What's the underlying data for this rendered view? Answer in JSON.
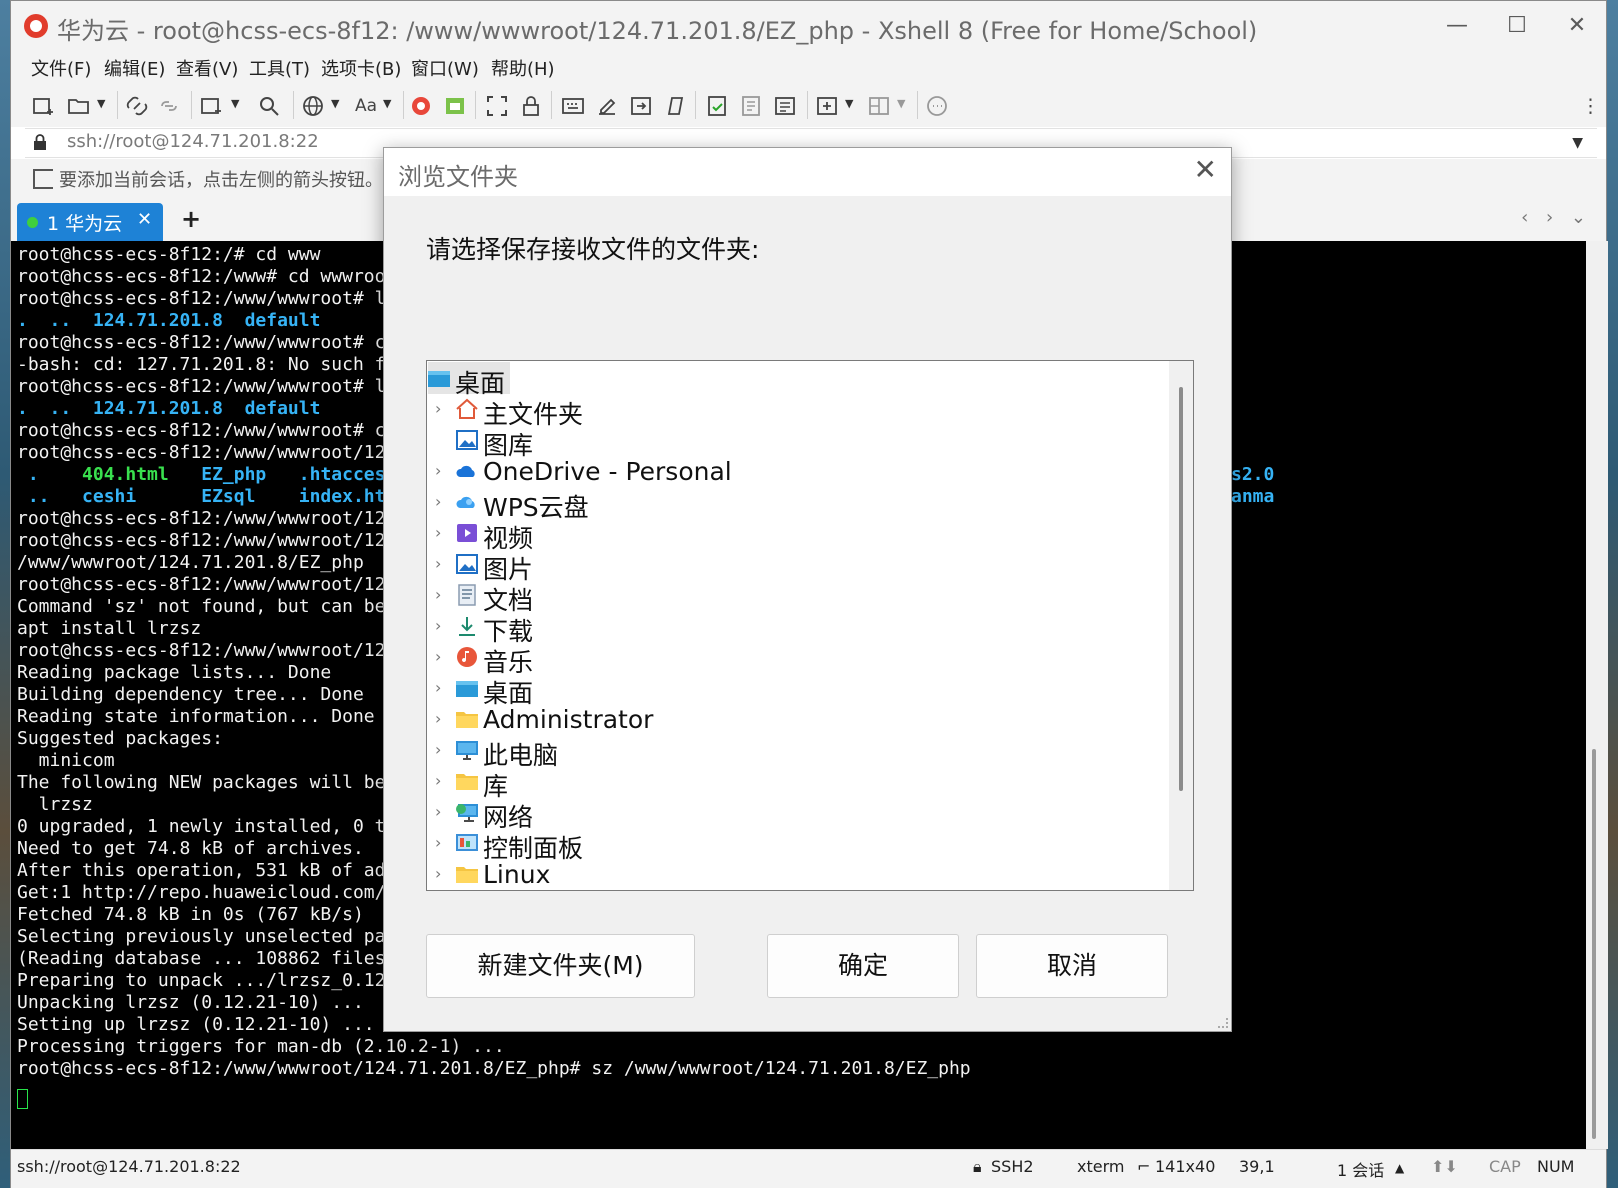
{
  "window": {
    "title": "华为云 - root@hcss-ecs-8f12: /www/wwwroot/124.71.201.8/EZ_php - Xshell 8 (Free for Home/School)",
    "minimize_glyph": "—",
    "maximize_glyph": "☐",
    "close_glyph": "✕"
  },
  "menu": [
    "文件(F)",
    "编辑(E)",
    "查看(V)",
    "工具(T)",
    "选项卡(B)",
    "窗口(W)",
    "帮助(H)"
  ],
  "toolbar": {
    "font_label": "Aa",
    "icons": [
      "new-session-icon",
      "open-folder-icon",
      "connect-icon",
      "disconnect-icon",
      "new-tab-icon",
      "search-icon",
      "globe-icon",
      "font-icon",
      "xftp-icon",
      "xagent-icon",
      "fullscreen-icon",
      "lock-icon",
      "keyboard-icon",
      "highlight-icon",
      "compose-icon",
      "script-icon",
      "log-icon",
      "transfer-icon",
      "layout-icon",
      "chat-icon"
    ]
  },
  "address": {
    "value": "ssh://root@124.71.201.8:22"
  },
  "hint": {
    "text": "要添加当前会话，点击左侧的箭头按钮。"
  },
  "tabs": [
    {
      "label": "1 华为云",
      "close": "✕"
    }
  ],
  "tab_add": "+",
  "tab_nav": "‹ › ⌄",
  "terminal": {
    "lines": [
      "root@hcss-ecs-8f12:/# cd www",
      "root@hcss-ecs-8f12:/www# cd wwwroo",
      "root@hcss-ecs-8f12:/www/wwwroot# l",
      "",
      "root@hcss-ecs-8f12:/www/wwwroot# c",
      "-bash: cd: 127.71.201.8: No such f",
      "root@hcss-ecs-8f12:/www/wwwroot# l",
      "",
      "root@hcss-ecs-8f12:/www/wwwroot# c",
      "root@hcss-ecs-8f12:/www/wwwroot/12",
      "",
      "",
      "root@hcss-ecs-8f12:/www/wwwroot/12",
      "root@hcss-ecs-8f12:/www/wwwroot/12",
      "/www/wwwroot/124.71.201.8/EZ_php",
      "root@hcss-ecs-8f12:/www/wwwroot/12",
      "Command 'sz' not found, but can be",
      "apt install lrzsz",
      "root@hcss-ecs-8f12:/www/wwwroot/12",
      "Reading package lists... Done",
      "Building dependency tree... Done",
      "Reading state information... Done",
      "Suggested packages:",
      "  minicom",
      "The following NEW packages will be",
      "  lrzsz",
      "0 upgraded, 1 newly installed, 0 t",
      "Need to get 74.8 kB of archives.",
      "After this operation, 531 kB of ad",
      "Get:1 http://repo.huaweicloud.com/",
      "Fetched 74.8 kB in 0s (767 kB/s)",
      "Selecting previously unselected pa",
      "(Reading database ... 108862 files",
      "Preparing to unpack .../lrzsz_0.12",
      "Unpacking lrzsz (0.12.21-10) ...",
      "Setting up lrzsz (0.12.21-10) ...",
      "Processing triggers for man-db (2.10.2-1) ...",
      "root@hcss-ecs-8f12:/www/wwwroot/124.71.201.8/EZ_php# sz /www/wwwroot/124.71.201.8/EZ_php"
    ],
    "ls1": ".  ..  124.71.201.8  default",
    "ls2": ".  ..  124.71.201.8  default",
    "ls3a": " .    404.html   EZ_php   .htacces",
    "ls3b": " ..   ceshi      EZsql    index.ht",
    "right1": "s2.0",
    "right2": "anma"
  },
  "status": {
    "connection": "ssh://root@124.71.201.8:22",
    "protocol": "SSH2",
    "terminal_type": "xterm",
    "size": "141x40",
    "cursor_pos": "39,1",
    "sessions": "1 会话",
    "cap": "CAP",
    "num": "NUM"
  },
  "dialog": {
    "title": "浏览文件夹",
    "close": "✕",
    "prompt": "请选择保存接收文件的文件夹:",
    "tree": [
      {
        "label": "桌面",
        "chevron": "",
        "selected": true
      },
      {
        "label": "主文件夹",
        "chevron": "›"
      },
      {
        "label": "图库",
        "chevron": ""
      },
      {
        "label": "OneDrive - Personal",
        "chevron": "›"
      },
      {
        "label": "WPS云盘",
        "chevron": "›"
      },
      {
        "label": "视频",
        "chevron": "›"
      },
      {
        "label": "图片",
        "chevron": "›"
      },
      {
        "label": "文档",
        "chevron": "›"
      },
      {
        "label": "下载",
        "chevron": "›"
      },
      {
        "label": "音乐",
        "chevron": "›"
      },
      {
        "label": "桌面",
        "chevron": "›"
      },
      {
        "label": "Administrator",
        "chevron": "›"
      },
      {
        "label": "此电脑",
        "chevron": "›"
      },
      {
        "label": "库",
        "chevron": "›"
      },
      {
        "label": "网络",
        "chevron": "›"
      },
      {
        "label": "控制面板",
        "chevron": "›"
      },
      {
        "label": "Linux",
        "chevron": "›"
      }
    ],
    "buttons": {
      "new_folder": "新建文件夹(M)",
      "ok": "确定",
      "cancel": "取消"
    }
  },
  "colors": {
    "tab_active": "#1e82d6",
    "terminal_bg": "#000000",
    "terminal_cyan": "#36b3f5",
    "terminal_green": "#39e04e"
  }
}
